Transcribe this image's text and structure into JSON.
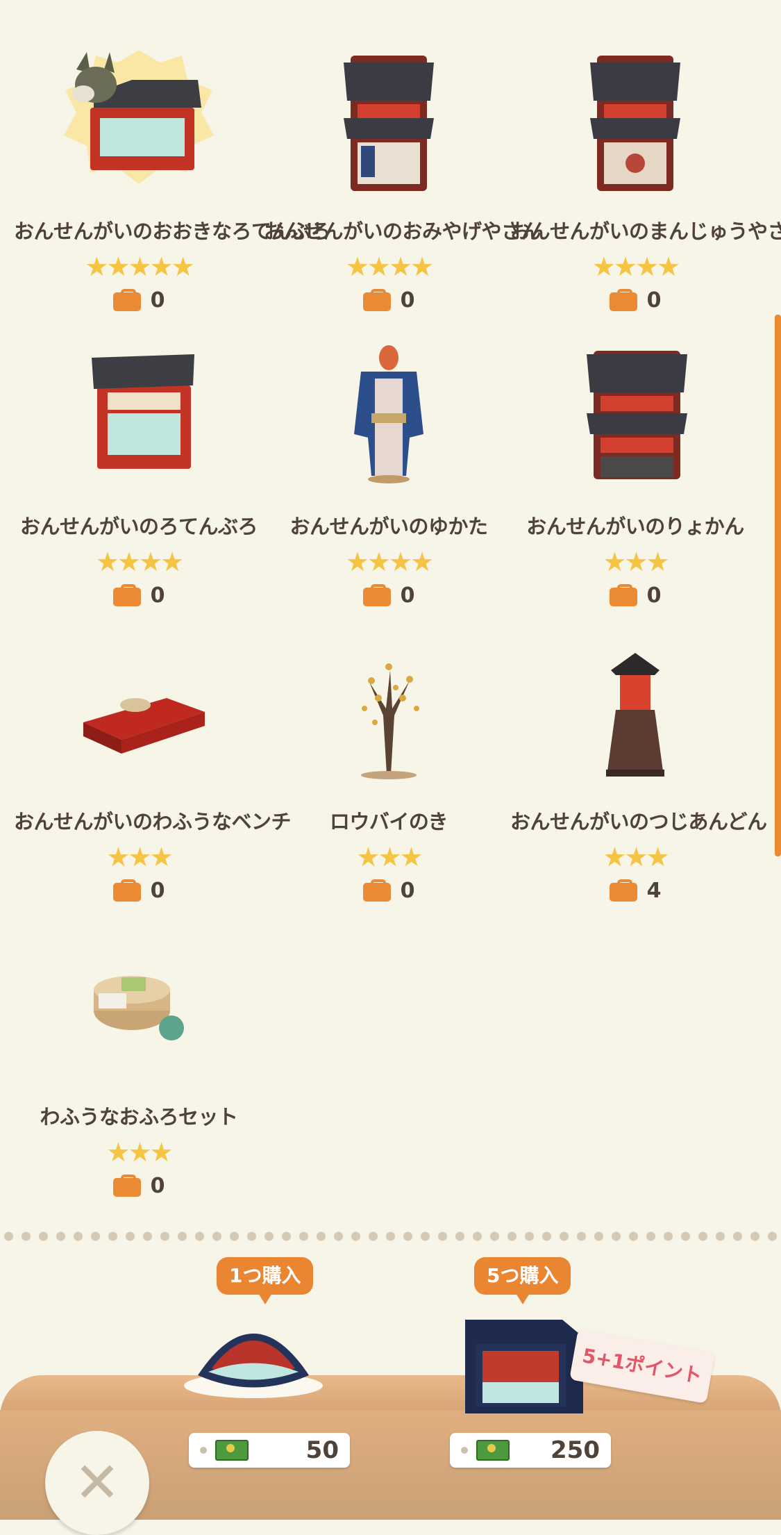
{
  "items": [
    {
      "name": "おんせんがいのおおきなろてんぶろ",
      "stars": "★★★★★",
      "count": "0",
      "icon": "open-air-bath-large"
    },
    {
      "name": "おんせんがいのおみやげやさん",
      "stars": "★★★★",
      "count": "0",
      "icon": "souvenir-shop"
    },
    {
      "name": "おんせんがいのまんじゅうやさん",
      "stars": "★★★★",
      "count": "0",
      "icon": "manju-shop"
    },
    {
      "name": "おんせんがいのろてんぶろ",
      "stars": "★★★★",
      "count": "0",
      "icon": "open-air-bath"
    },
    {
      "name": "おんせんがいのゆかた",
      "stars": "★★★★",
      "count": "0",
      "icon": "yukata"
    },
    {
      "name": "おんせんがいのりょかん",
      "stars": "★★★",
      "count": "0",
      "icon": "ryokan"
    },
    {
      "name": "おんせんがいのわふうなベンチ",
      "stars": "★★★",
      "count": "0",
      "icon": "bench"
    },
    {
      "name": "ロウバイのき",
      "stars": "★★★",
      "count": "0",
      "icon": "wintersweet-tree"
    },
    {
      "name": "おんせんがいのつじあんどん",
      "stars": "★★★",
      "count": "4",
      "icon": "lantern"
    },
    {
      "name": "わふうなおふろセット",
      "stars": "★★★",
      "count": "0",
      "icon": "bath-set"
    }
  ],
  "purchase": {
    "single": {
      "label": "1つ購入",
      "price": "50"
    },
    "bulk": {
      "label": "5つ購入",
      "price": "250",
      "bonus": "5+1ポイント"
    }
  },
  "colors": {
    "accent": "#ea8632",
    "star": "#f6c443",
    "background": "#f7f4e8"
  }
}
